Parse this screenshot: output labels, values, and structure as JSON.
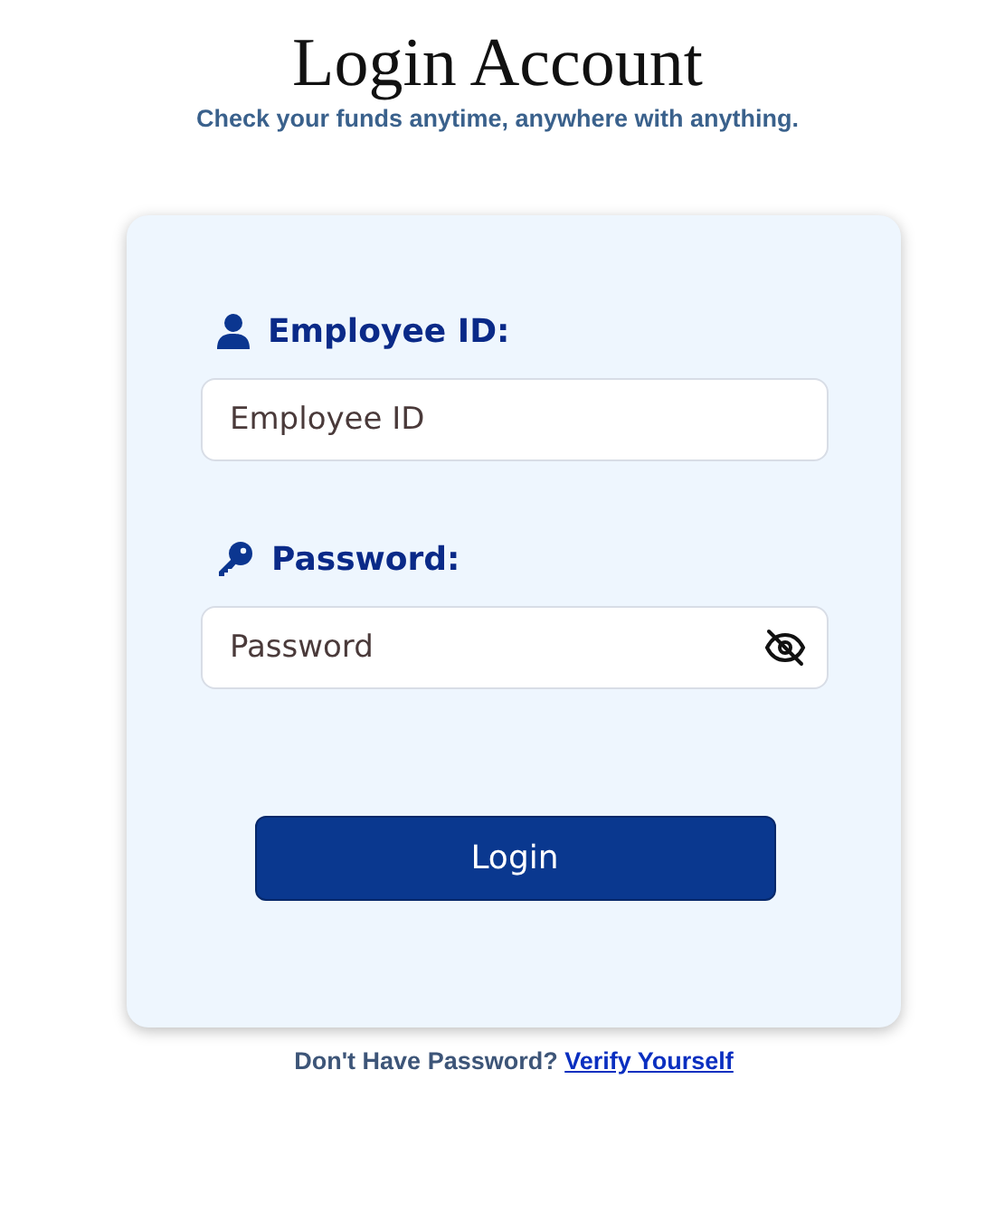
{
  "title": "Login Account",
  "subtitle": "Check your funds anytime, anywhere with anything.",
  "fields": [
    {
      "kind": "text",
      "label": "Employee ID:",
      "placeholder": "Employee ID"
    },
    {
      "kind": "password",
      "label": "Password:",
      "placeholder": "Password"
    }
  ],
  "button": "Login",
  "footer": {
    "text": "Don't Have Password?",
    "link": "Verify Yourself"
  }
}
